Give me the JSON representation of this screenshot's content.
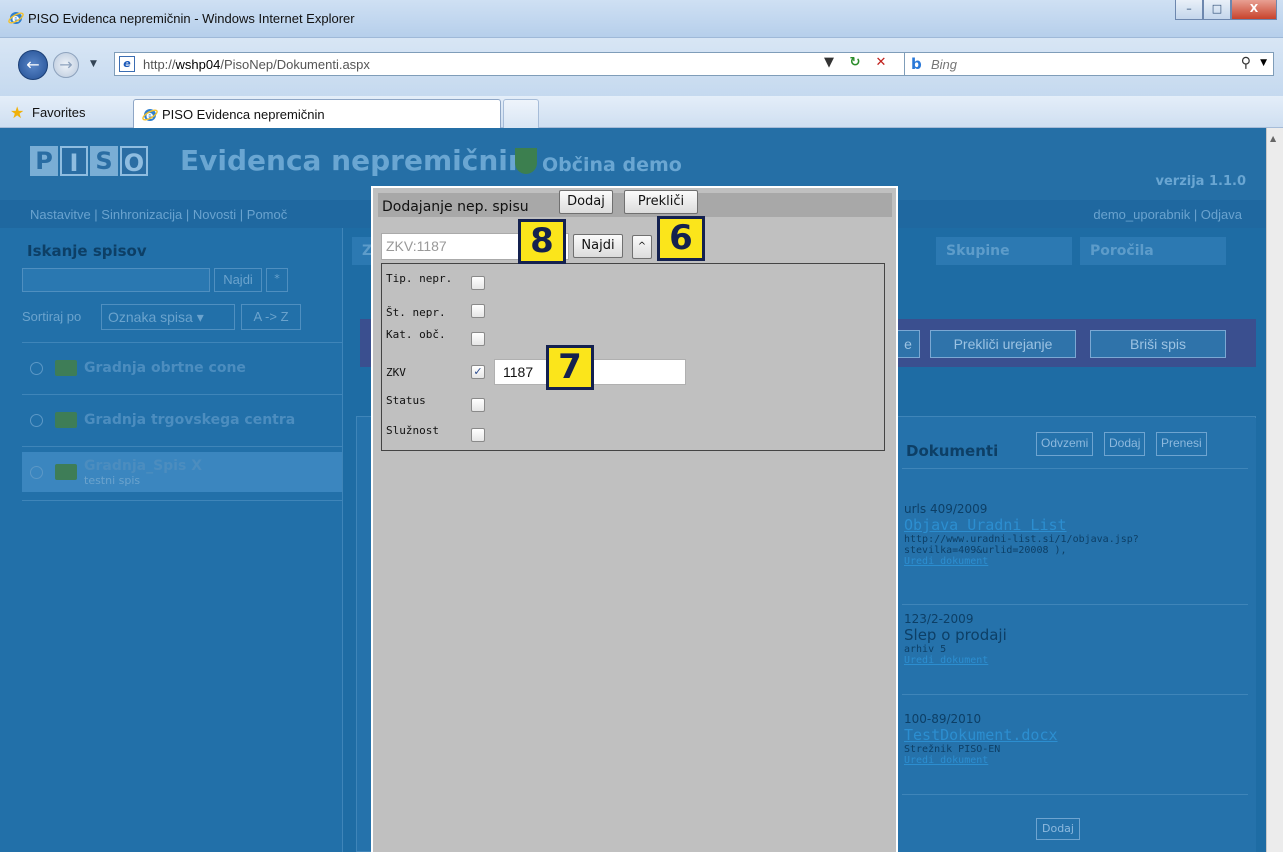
{
  "browser": {
    "window_title": "PISO Evidenca nepremičnin - Windows Internet Explorer",
    "url_prefix": "http://",
    "url_host": "wshp04",
    "url_path": "/PisoNep/Dokumenti.aspx",
    "search_engine": "Bing",
    "favorites_label": "Favorites",
    "tab_title": "PISO Evidenca nepremičnin"
  },
  "site": {
    "logo_letters": [
      "P",
      "I",
      "S",
      "O"
    ],
    "title": "Evidenca nepremičnin",
    "municipality": "Občina demo",
    "version": "verzija 1.1.0",
    "nav_links": "Nastavitve | Sinhronizacija | Novosti | Pomoč",
    "user_links": "demo_uporabnik  |  Odjava"
  },
  "left_panel": {
    "title": "Iskanje spisov",
    "search_button": "Najdi",
    "star_button": "*",
    "sort_label": "Sortiraj po",
    "sort_value": "Oznaka spisa",
    "sort_order": "A -> Z",
    "items": [
      {
        "name": "Gradnja obrtne cone",
        "sub": ""
      },
      {
        "name": "Gradnja trgovskega centra",
        "sub": ""
      },
      {
        "name": "Gradnja_Spis X",
        "sub": "testni spis"
      }
    ]
  },
  "main": {
    "tabs": [
      "Z",
      "Skupine",
      "Poročila"
    ],
    "actions": [
      "e",
      "Prekliči urejanje",
      "Briši spis"
    ]
  },
  "documents": {
    "title": "Dokumenti",
    "buttons": [
      "Odvzemi",
      "Dodaj",
      "Prenesi"
    ],
    "entries": [
      {
        "number": "urls 409/2009",
        "title": "Objava Uradni List",
        "meta": "http://www.uradni-list.si/1/objava.jsp?stevilka=409&urlid=20008 ),",
        "edit": "Uredi dokument"
      },
      {
        "number": "123/2-2009",
        "title": "Slep o prodaji",
        "meta": "arhiv 5",
        "edit": "Uredi dokument"
      },
      {
        "number": "100-89/2010",
        "title": "TestDokument.docx",
        "meta": "Strežnik PISO-EN",
        "edit": "Uredi dokument"
      }
    ],
    "bottom_button": "Dodaj"
  },
  "modal": {
    "title": "Dodajanje nep. spisu",
    "add_button": "Dodaj",
    "cancel_button": "Prekliči",
    "search_placeholder": "ZKV:1187",
    "find_button": "Najdi",
    "collapse_button": "^",
    "filters": [
      {
        "label": "Tip. nepr.",
        "checked": false
      },
      {
        "label": "Št. nepr.",
        "checked": false
      },
      {
        "label": "Kat. obč.",
        "checked": false
      },
      {
        "label": "ZKV",
        "checked": true,
        "value": "1187"
      },
      {
        "label": "Status",
        "checked": false
      },
      {
        "label": "Služnost",
        "checked": false
      }
    ]
  },
  "callouts": [
    "8",
    "6",
    "7"
  ],
  "colors": {
    "callout_bg": "#fbe51b",
    "callout_border": "#14214f",
    "page_bg": "#1e6ca4"
  }
}
